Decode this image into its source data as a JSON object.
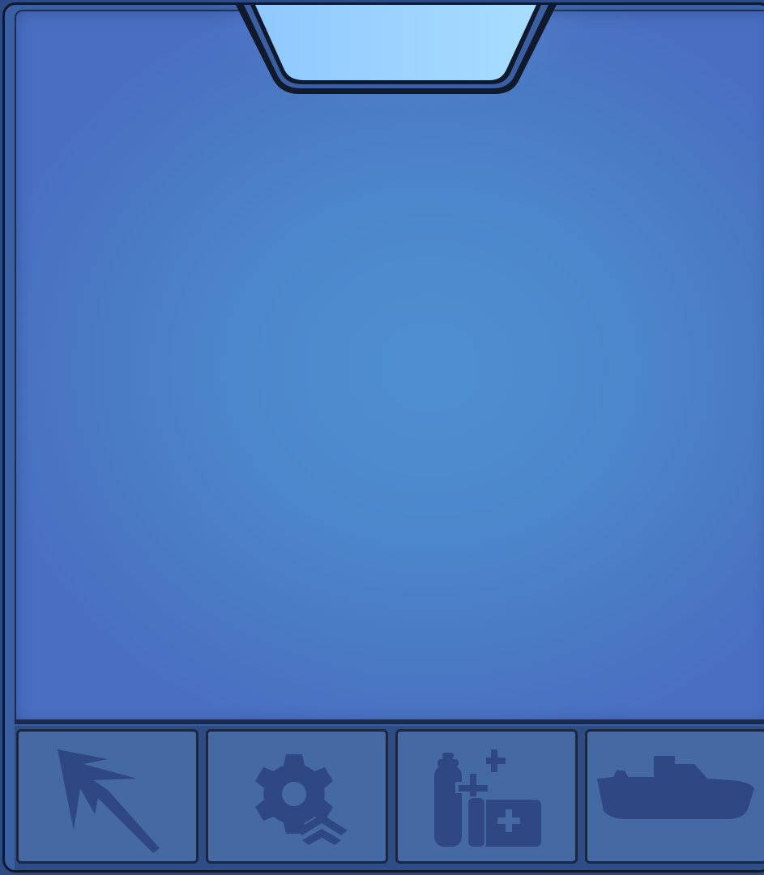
{
  "theme": {
    "frame": "#2b4a86",
    "screen_center": "#4f8fd0",
    "screen_edge": "#4a6fc2",
    "tab_fill": "#8fc8ff",
    "button_fill": "#4569a3",
    "icon_color": "#2f4783",
    "border": "#111a2c"
  },
  "top_tab": {
    "icon": "none",
    "state": "highlighted"
  },
  "toolbar": {
    "buttons": [
      {
        "name": "cursor-burst-button",
        "icon": "cursor-burst-icon"
      },
      {
        "name": "gear-upgrade-button",
        "icon": "gear-upgrade-icon"
      },
      {
        "name": "medical-supplies-button",
        "icon": "oxygen-medkit-icon"
      },
      {
        "name": "boat-button",
        "icon": "boat-icon"
      }
    ]
  }
}
